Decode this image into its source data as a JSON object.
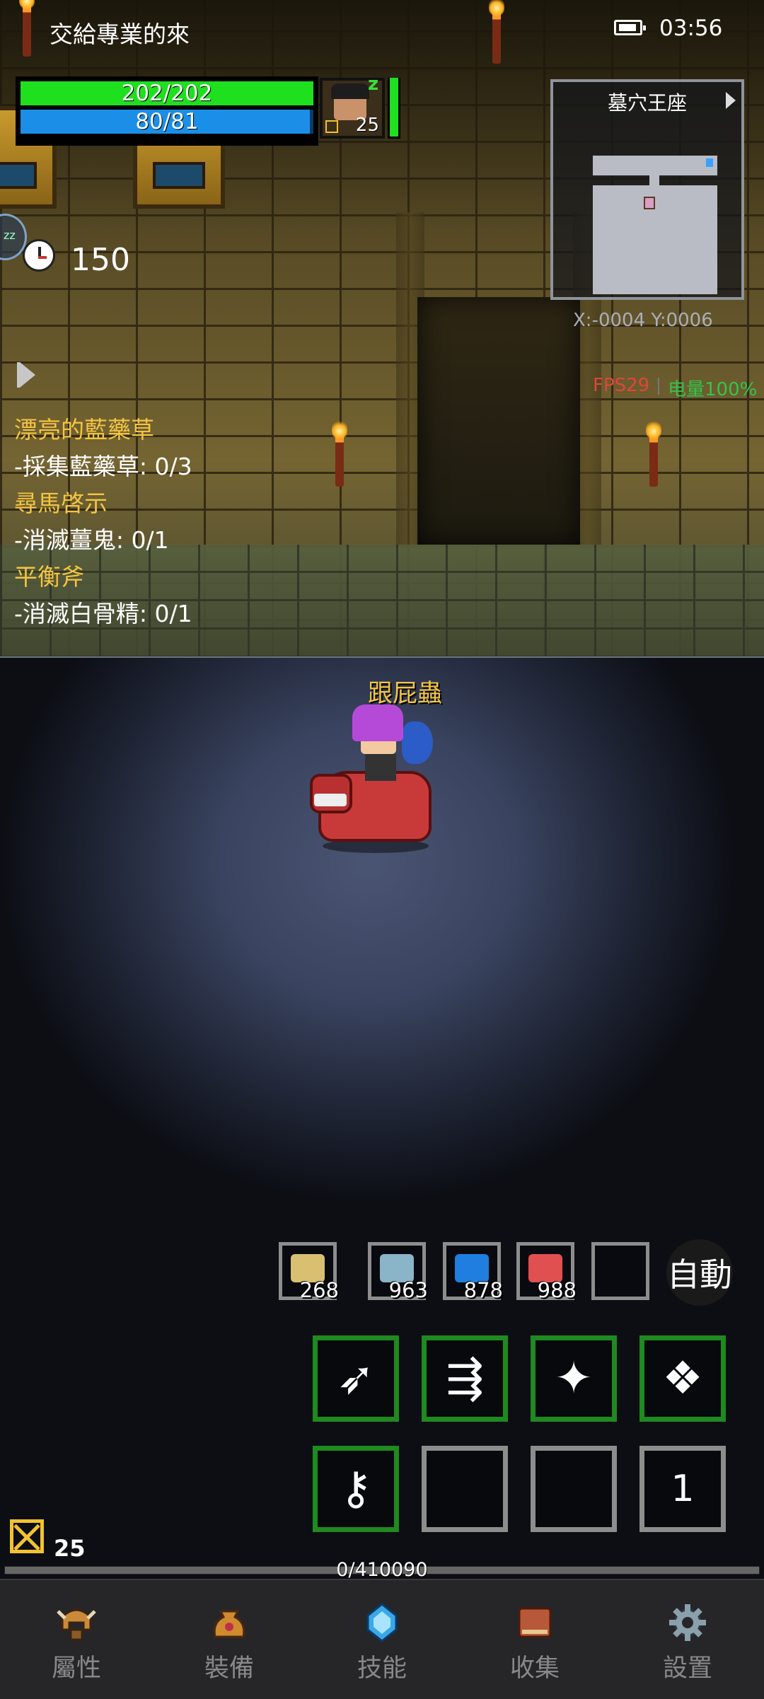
{
  "status_bar": {
    "title": "交給專業的來",
    "time": "03:56"
  },
  "player": {
    "hp": "202/202",
    "hp_fraction": 1.0,
    "mp": "80/81",
    "mp_fraction": 0.988,
    "level": "25",
    "stamina_fraction": 1.0
  },
  "minimap": {
    "title": "墓穴王座",
    "coords": "X:-0004  Y:0006"
  },
  "perf": {
    "fps": "FPS29",
    "power": "电量100%"
  },
  "timer": "150",
  "quests": [
    {
      "title": "漂亮的藍藥草",
      "task": "-採集藍藥草: 0/3"
    },
    {
      "title": "尋馬啓示",
      "task": "-消滅薑鬼: 0/1"
    },
    {
      "title": "平衡斧",
      "task": "-消滅白骨精: 0/1"
    }
  ],
  "pet_name": "跟屁蟲",
  "quickbar": {
    "items": [
      {
        "icon": "scroll-icon",
        "count": "268",
        "color": "#d8c070"
      },
      {
        "icon": "fish-icon",
        "count": "963",
        "color": "#8ab4c8"
      },
      {
        "icon": "blue-potion-icon",
        "count": "878",
        "color": "#1f7ee0"
      },
      {
        "icon": "red-potion-icon",
        "count": "988",
        "color": "#e05050"
      },
      {
        "icon": "empty-slot",
        "count": "",
        "color": ""
      }
    ],
    "auto_label": "自動"
  },
  "skills": [
    {
      "icon": "piercing-arrow-icon",
      "glyph": "➶",
      "empty": false
    },
    {
      "icon": "multi-arrow-icon",
      "glyph": "⇶",
      "empty": false
    },
    {
      "icon": "spread-shot-icon",
      "glyph": "✦",
      "empty": false
    },
    {
      "icon": "summon-beast-icon",
      "glyph": "❖",
      "empty": false
    },
    {
      "icon": "key-skill-icon",
      "glyph": "⚷",
      "empty": false
    },
    {
      "icon": "empty-skill-slot",
      "glyph": "",
      "empty": true
    },
    {
      "icon": "empty-skill-slot",
      "glyph": "",
      "empty": true
    },
    {
      "icon": "skill-page-indicator",
      "glyph": "1",
      "empty": true
    }
  ],
  "level_badge": "25",
  "exp": {
    "text": "0/410090",
    "fraction": 0.0
  },
  "nav": [
    {
      "label": "屬性",
      "icon": "helmet-icon",
      "color": "#c98a3a"
    },
    {
      "label": "裝備",
      "icon": "bag-icon",
      "color": "#d08a30"
    },
    {
      "label": "技能",
      "icon": "crystal-icon",
      "color": "#3aa8e8"
    },
    {
      "label": "收集",
      "icon": "book-icon",
      "color": "#b8583a"
    },
    {
      "label": "設置",
      "icon": "gear-icon",
      "color": "#8aa0aa"
    }
  ]
}
